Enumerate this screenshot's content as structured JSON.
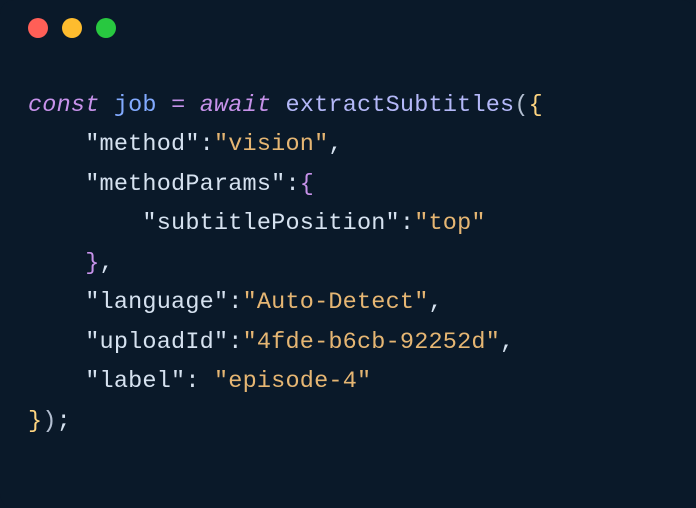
{
  "code": {
    "kw_const": "const",
    "varname": "job",
    "op_eq": "=",
    "kw_await": "await",
    "fn_name": "extractSubtitles",
    "open_paren": "(",
    "open_brace_outer": "{",
    "keys": {
      "method": "\"method\"",
      "methodParams": "\"methodParams\"",
      "subtitlePosition": "\"subtitlePosition\"",
      "language": "\"language\"",
      "uploadId": "\"uploadId\"",
      "label": "\"label\""
    },
    "values": {
      "method": "\"vision\"",
      "subtitlePosition": "\"top\"",
      "language": "\"Auto-Detect\"",
      "uploadId": "\"4fde-b6cb-92252d\"",
      "label": "\"episode-4\""
    },
    "open_brace_inner": "{",
    "close_brace_inner": "}",
    "close_brace_outer": "}",
    "close_paren": ")",
    "semi": ";",
    "colon": ":",
    "comma": ",",
    "sp": " "
  }
}
